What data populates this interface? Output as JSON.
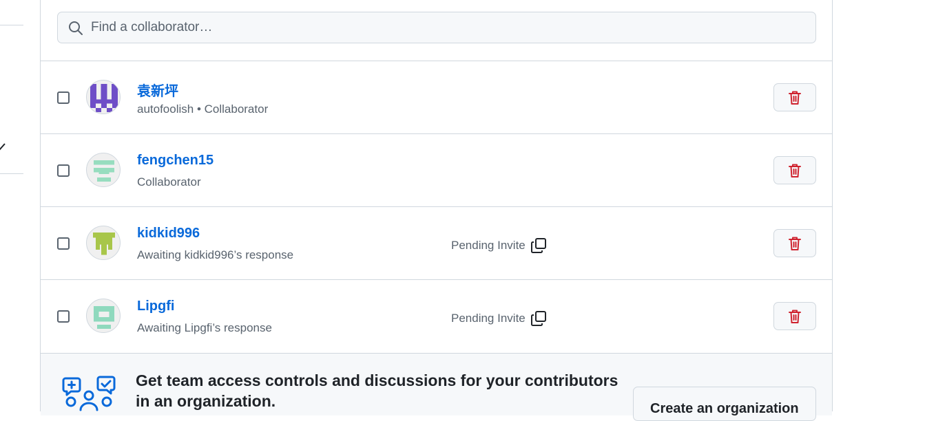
{
  "search": {
    "placeholder": "Find a collaborator…"
  },
  "collaborators": [
    {
      "name": "袁新坪",
      "subtitle": "autofoolish • Collaborator",
      "pending_label": "",
      "avatar_color": "#6e4ec7"
    },
    {
      "name": "fengchen15",
      "subtitle": "Collaborator",
      "pending_label": "",
      "avatar_color": "#97ddbf"
    },
    {
      "name": "kidkid996",
      "subtitle": "Awaiting kidkid996’s response",
      "pending_label": "Pending Invite",
      "avatar_color": "#a8c64a"
    },
    {
      "name": "Lipgfi",
      "subtitle": "Awaiting Lipgfi’s response",
      "pending_label": "Pending Invite",
      "avatar_color": "#8fd9bd"
    }
  ],
  "promo": {
    "text": "Get team access controls and discussions for your contributors in an organization.",
    "button_label": "Create an organization"
  },
  "colors": {
    "link": "#0969da",
    "danger": "#cf222e",
    "border": "#d0d7de",
    "muted": "#59636e",
    "accent_icon": "#0969da"
  },
  "icons": [
    "search-icon",
    "copy-icon",
    "trash-icon",
    "people-icon"
  ]
}
